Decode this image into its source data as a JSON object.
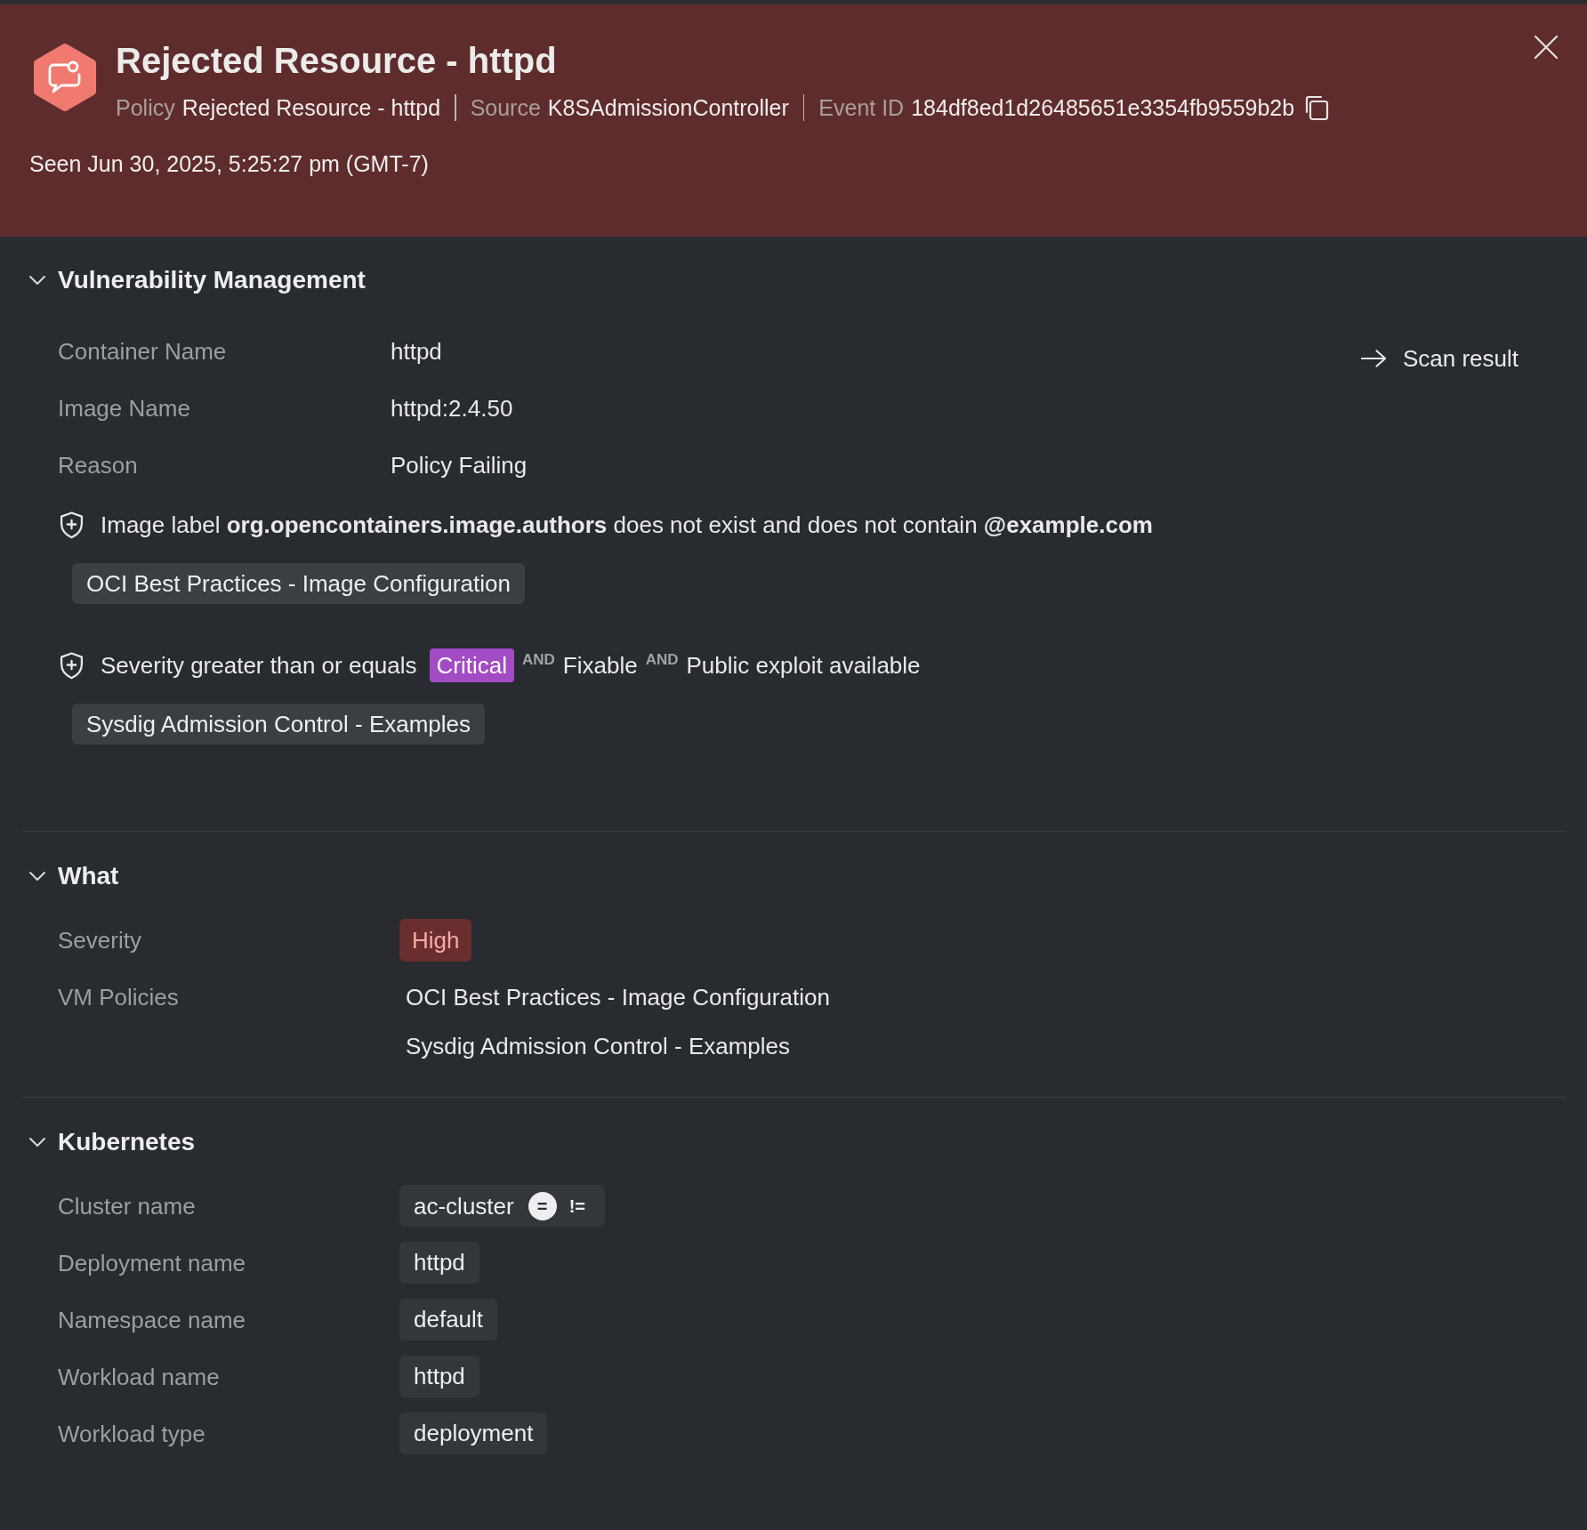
{
  "header": {
    "title": "Rejected Resource - httpd",
    "meta": [
      {
        "label": "Policy",
        "value": "Rejected Resource - httpd",
        "copyable": false
      },
      {
        "label": "Source",
        "value": "K8SAdmissionController",
        "copyable": false
      },
      {
        "label": "Event ID",
        "value": "184df8ed1d26485651e3354fb9559b2b",
        "copyable": true
      }
    ],
    "seen": "Seen Jun 30, 2025, 5:25:27 pm (GMT-7)"
  },
  "sections": [
    {
      "title": "Vulnerability Management",
      "expanded": true,
      "link": "Scan result",
      "fields": [
        {
          "label": "Container Name",
          "kind": "text",
          "value": "httpd"
        },
        {
          "label": "Image Name",
          "kind": "text",
          "value": "httpd:2.4.50"
        },
        {
          "label": "Reason",
          "kind": "text",
          "value": "Policy Failing"
        }
      ],
      "rules": [
        {
          "parts": [
            {
              "kind": "text",
              "text": "Image label **org.opencontainers.image.authors** does not exist and does not contain **@example.com**"
            }
          ],
          "policy": "OCI Best Practices - Image Configuration"
        },
        {
          "parts": [
            {
              "kind": "text",
              "text": "Severity greater than or equals"
            },
            {
              "kind": "badge",
              "text": "Critical",
              "color": "#a24bc4"
            },
            {
              "kind": "operator",
              "text": "AND"
            },
            {
              "kind": "text",
              "text": "Fixable"
            },
            {
              "kind": "operator",
              "text": "AND"
            },
            {
              "kind": "text",
              "text": "Public exploit available"
            }
          ],
          "policy": "Sysdig Admission Control - Examples"
        }
      ]
    },
    {
      "title": "What",
      "expanded": true,
      "fields": [
        {
          "label": "Severity",
          "kind": "badge",
          "value": "High",
          "color": "#6a2e2e"
        },
        {
          "label": "VM Policies",
          "kind": "list",
          "values": [
            "OCI Best Practices - Image Configuration",
            "Sysdig Admission Control - Examples"
          ]
        }
      ]
    },
    {
      "title": "Kubernetes",
      "expanded": true,
      "fields": [
        {
          "label": "Cluster name",
          "kind": "chip",
          "value": "ac-cluster",
          "operators": [
            {
              "label": "=",
              "selected": true
            },
            {
              "label": "!=",
              "selected": false
            }
          ]
        },
        {
          "label": "Deployment name",
          "kind": "chip",
          "value": "httpd"
        },
        {
          "label": "Namespace name",
          "kind": "chip",
          "value": "default"
        },
        {
          "label": "Workload name",
          "kind": "chip",
          "value": "httpd"
        },
        {
          "label": "Workload type",
          "kind": "chip",
          "value": "deployment"
        }
      ]
    }
  ]
}
